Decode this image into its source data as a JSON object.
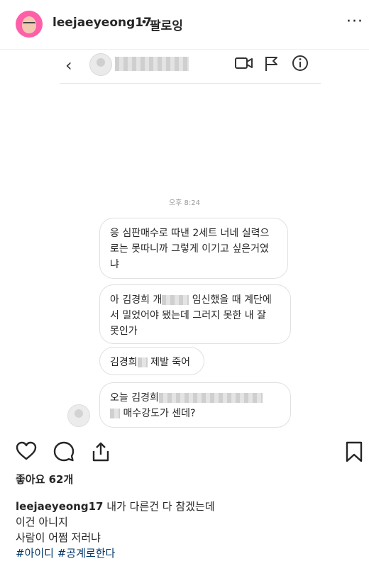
{
  "header": {
    "username": "leejaeyeong17",
    "separator": "•",
    "follow_label": "팔로잉",
    "more_glyph": "···"
  },
  "dm": {
    "back_glyph": "‹",
    "icons": [
      "video-icon",
      "flag-icon",
      "info-icon"
    ],
    "timestamp": "오후 8:24",
    "messages": {
      "m1": {
        "line1": "응 심판매수로 따낸 2세트 너네 실력으",
        "line2": "로는 못따니까 그렇게 이기고 싶은거였",
        "line3": "냐"
      },
      "m2": {
        "line1a": "아 김경희 개",
        "line1b": "임신했을 때 계단에",
        "line2": "서 밀었어야 됐는데 그러지 못한 내 잘",
        "line3": "못인가"
      },
      "m3": {
        "text_a": "김경희",
        "text_b": "제발 죽어"
      },
      "m4": {
        "line1": "오늘 김경희",
        "line2": "매수강도가 센데?"
      }
    }
  },
  "post": {
    "icons": [
      "heart-icon",
      "comment-icon",
      "share-icon",
      "bookmark-icon"
    ],
    "likes": "좋아요 62개",
    "caption_user": "leejaeyeong17",
    "caption_line1": " 내가 다른건 다 참겠는데",
    "caption_line2": "이건 아니지",
    "caption_line3": "사람이 어쩜 저러냐",
    "hashtags": "#아이디 #공계로한다"
  }
}
